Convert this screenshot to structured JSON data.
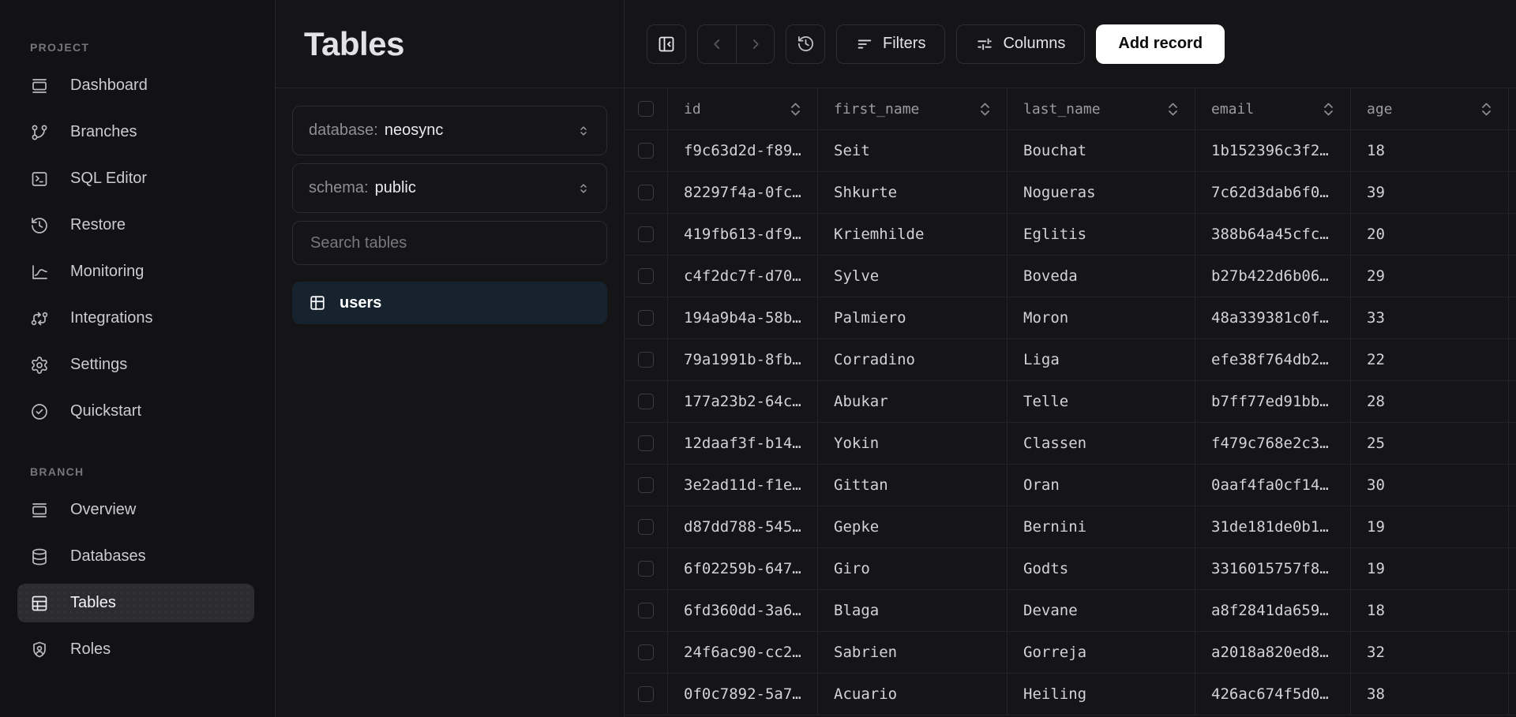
{
  "sidebar": {
    "sections": [
      {
        "label": "PROJECT",
        "items": [
          {
            "label": "Dashboard",
            "icon": "dashboard-icon"
          },
          {
            "label": "Branches",
            "icon": "git-branch-icon"
          },
          {
            "label": "SQL Editor",
            "icon": "terminal-icon"
          },
          {
            "label": "Restore",
            "icon": "history-icon"
          },
          {
            "label": "Monitoring",
            "icon": "chart-icon"
          },
          {
            "label": "Integrations",
            "icon": "git-compare-icon"
          },
          {
            "label": "Settings",
            "icon": "gear-icon"
          },
          {
            "label": "Quickstart",
            "icon": "circle-check-icon"
          }
        ]
      },
      {
        "label": "BRANCH",
        "items": [
          {
            "label": "Overview",
            "icon": "overview-icon"
          },
          {
            "label": "Databases",
            "icon": "database-icon"
          },
          {
            "label": "Tables",
            "icon": "table-icon",
            "active": true
          },
          {
            "label": "Roles",
            "icon": "shield-user-icon"
          }
        ]
      }
    ]
  },
  "tables_panel": {
    "title": "Tables",
    "database_label": "database:",
    "database_value": "neosync",
    "schema_label": "schema:",
    "schema_value": "public",
    "search_placeholder": "Search tables",
    "selected_table": "users"
  },
  "toolbar": {
    "collapse_icon": "panel-left-close-icon",
    "back_icon": "chevron-left-icon",
    "forward_icon": "chevron-right-icon",
    "history_icon": "history-icon",
    "filters_label": "Filters",
    "filters_icon": "filter-lines-icon",
    "columns_label": "Columns",
    "columns_icon": "sliders-icon",
    "add_record_label": "Add record"
  },
  "table": {
    "columns": [
      "id",
      "first_name",
      "last_name",
      "email",
      "age"
    ],
    "rows": [
      {
        "id": "f9c63d2d-f89…",
        "first_name": "Seit",
        "last_name": "Bouchat",
        "email": "1b152396c3f2…",
        "age": "18"
      },
      {
        "id": "82297f4a-0fc…",
        "first_name": "Shkurte",
        "last_name": "Nogueras",
        "email": "7c62d3dab6f0…",
        "age": "39"
      },
      {
        "id": "419fb613-df9…",
        "first_name": "Kriemhilde",
        "last_name": "Eglitis",
        "email": "388b64a45cfc…",
        "age": "20"
      },
      {
        "id": "c4f2dc7f-d70…",
        "first_name": "Sylve",
        "last_name": "Boveda",
        "email": "b27b422d6b06…",
        "age": "29"
      },
      {
        "id": "194a9b4a-58b…",
        "first_name": "Palmiero",
        "last_name": "Moron",
        "email": "48a339381c0f…",
        "age": "33"
      },
      {
        "id": "79a1991b-8fb…",
        "first_name": "Corradino",
        "last_name": "Liga",
        "email": "efe38f764db2…",
        "age": "22"
      },
      {
        "id": "177a23b2-64c…",
        "first_name": "Abukar",
        "last_name": "Telle",
        "email": "b7ff77ed91bb…",
        "age": "28"
      },
      {
        "id": "12daaf3f-b14…",
        "first_name": "Yokin",
        "last_name": "Classen",
        "email": "f479c768e2c3…",
        "age": "25"
      },
      {
        "id": "3e2ad11d-f1e…",
        "first_name": "Gittan",
        "last_name": "Oran",
        "email": "0aaf4fa0cf14…",
        "age": "30"
      },
      {
        "id": "d87dd788-545…",
        "first_name": "Gepke",
        "last_name": "Bernini",
        "email": "31de181de0b1…",
        "age": "19"
      },
      {
        "id": "6f02259b-647…",
        "first_name": "Giro",
        "last_name": "Godts",
        "email": "3316015757f8…",
        "age": "19"
      },
      {
        "id": "6fd360dd-3a6…",
        "first_name": "Blaga",
        "last_name": "Devane",
        "email": "a8f2841da659…",
        "age": "18"
      },
      {
        "id": "24f6ac90-cc2…",
        "first_name": "Sabrien",
        "last_name": "Gorreja",
        "email": "a2018a820ed8…",
        "age": "32"
      },
      {
        "id": "0f0c7892-5a7…",
        "first_name": "Acuario",
        "last_name": "Heiling",
        "email": "426ac674f5d0…",
        "age": "38"
      }
    ]
  },
  "colors": {
    "page_bg": "#151517",
    "sidebar_bg": "#121214",
    "border": "#27272b",
    "active_item_bg": "#2c2c30",
    "selected_table_bg": "#16232e",
    "primary_button_bg": "#ffffff",
    "primary_button_text": "#0b0b0d",
    "text_primary": "#e6e7e9",
    "text_muted": "#9b9ca2"
  }
}
